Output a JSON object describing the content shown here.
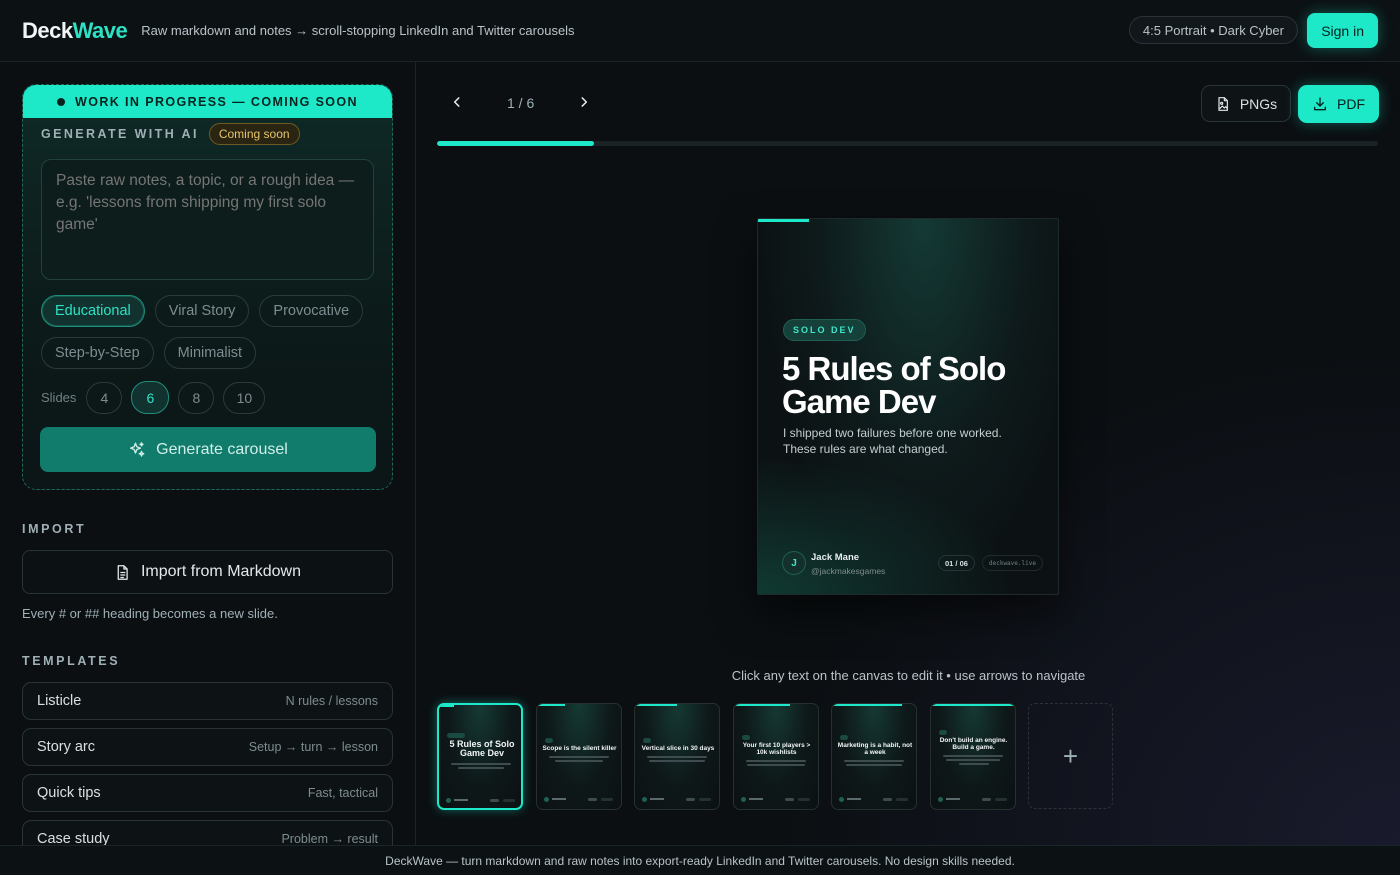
{
  "header": {
    "logo_part1": "Deck",
    "logo_part2": "Wave",
    "tagline": "Raw markdown and notes → scroll-stopping LinkedIn and Twitter carousels",
    "format": "4:5 Portrait • Dark Cyber",
    "signin_label": "Sign in"
  },
  "sidebar": {
    "wip_banner": "WORK IN PROGRESS — COMING SOON",
    "generate_title": "GENERATE WITH AI",
    "coming_soon": "Coming soon",
    "ai_placeholder": "Paste raw notes, a topic, or a rough idea — e.g. 'lessons from shipping my first solo game'",
    "tones": [
      {
        "label": "Educational",
        "active": true
      },
      {
        "label": "Viral Story",
        "active": false
      },
      {
        "label": "Provocative",
        "active": false
      },
      {
        "label": "Step-by-Step",
        "active": false
      },
      {
        "label": "Minimalist",
        "active": false
      }
    ],
    "slides_label": "Slides",
    "slide_counts": [
      "4",
      "6",
      "8",
      "10"
    ],
    "slide_count_selected": "6",
    "generate_label": "Generate carousel",
    "import_title": "IMPORT",
    "import_label": "Import from Markdown",
    "import_hint": "Every # or ## heading becomes a new slide.",
    "templates_title": "TEMPLATES",
    "templates": [
      {
        "name": "Listicle",
        "desc": "N rules / lessons"
      },
      {
        "name": "Story arc",
        "desc": "Setup → turn → lesson"
      },
      {
        "name": "Quick tips",
        "desc": "Fast, tactical"
      },
      {
        "name": "Case study",
        "desc": "Problem → result"
      }
    ]
  },
  "main": {
    "page_indicator": "1 / 6",
    "progress_fraction": 0.1667,
    "export_png": "PNGs",
    "export_pdf": "PDF",
    "slide": {
      "tag": "SOLO DEV",
      "title": "5 Rules of Solo Game Dev",
      "subtitle": "I shipped two failures before one worked. These rules are what changed.",
      "avatar_initial": "J",
      "author": "Jack Mane",
      "handle": "@jackmakesgames",
      "counter": "01 / 06",
      "site": "deckwave.live"
    },
    "edit_hint": "Click any text on the canvas to edit it • use arrows to navigate",
    "thumbnails": [
      {
        "title": "5 Rules of Solo Game Dev"
      },
      {
        "title": "Scope is the silent killer"
      },
      {
        "title": "Vertical slice in 30 days"
      },
      {
        "title": "Your first 10 players > 10k wishlists"
      },
      {
        "title": "Marketing is a habit, not a week"
      },
      {
        "title": "Don't build an engine. Build a game."
      }
    ],
    "add_slide": "+"
  },
  "footer": {
    "text": "DeckWave — turn markdown and raw notes into export-ready LinkedIn and Twitter carousels. No design skills needed."
  },
  "colors": {
    "accent": "#1de9c8",
    "background": "#0b0f12",
    "warning": "#e6c36a"
  }
}
